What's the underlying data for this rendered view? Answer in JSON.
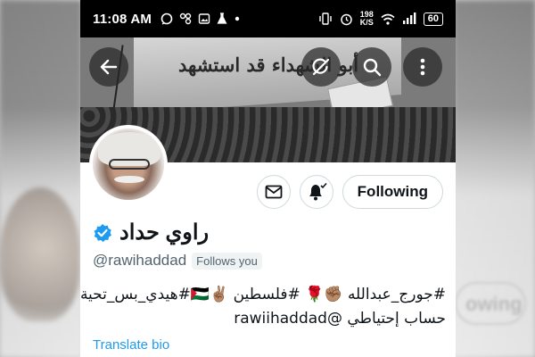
{
  "status_bar": {
    "time": "11:08 AM",
    "left_icons": [
      "whatsapp-icon",
      "app-icon",
      "gallery-icon",
      "lab-icon",
      "dot-icon"
    ],
    "net_speed_value": "198",
    "net_speed_unit": "K/S",
    "battery": "60"
  },
  "banner": {
    "slogan": "أبو الشهداء قد استشهد"
  },
  "header_buttons": {
    "back": "arrow-left-icon",
    "grok": "grok-icon",
    "search": "search-icon",
    "more": "more-vertical-icon"
  },
  "profile": {
    "display_name": "راوي حداد",
    "verified": true,
    "handle": "@rawihaddad",
    "follows_you": "Follows you",
    "bio_line_1": "#جورج_عبدالله ✊🏽🌹 #فلسطين ✌🏽🇵🇸#هيدي_بس_تحية",
    "bio_line_2": "حساب إحتياطي @rawiihaddad",
    "translate_label": "Translate bio"
  },
  "actions": {
    "message_icon": "envelope-icon",
    "notify_icon": "bell-check-icon",
    "following_label": "Following"
  },
  "colors": {
    "accent": "#1d9bf0",
    "text_primary": "#0f1419",
    "text_secondary": "#536471",
    "border": "#cfd9de"
  },
  "background": {
    "right_button_fragment": "owing"
  }
}
